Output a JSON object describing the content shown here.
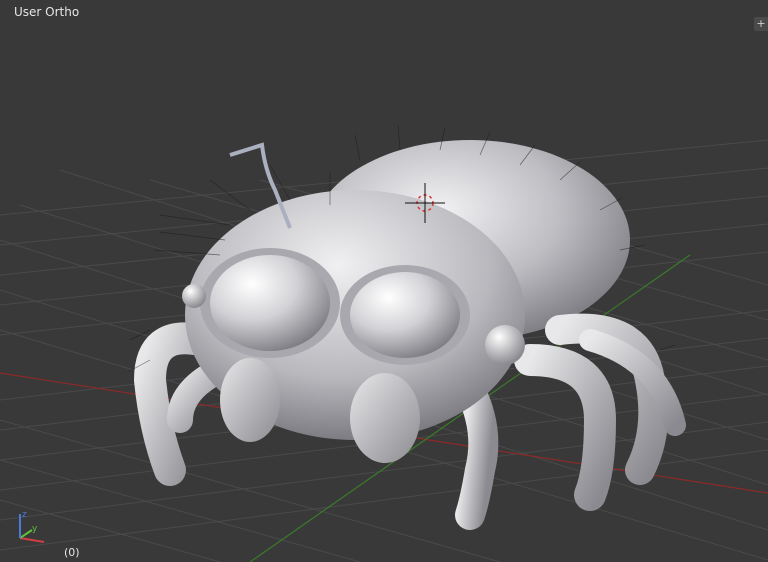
{
  "viewport": {
    "view_label": "User Ortho",
    "frame_label": "(0)",
    "corner_widget_label": "+"
  },
  "axis_gizmo": {
    "z_label": "z",
    "y_label": "y",
    "x_color": "#d04040",
    "y_color": "#5fbf3f",
    "z_color": "#4a7bd6"
  },
  "colors": {
    "background": "#393939",
    "grid": "#4a4a4a",
    "x_axis_line": "#8a2a2a",
    "y_axis_line": "#3a7a2a",
    "model": "#c8c8cc"
  },
  "model": {
    "name_icon": "spider-model"
  }
}
